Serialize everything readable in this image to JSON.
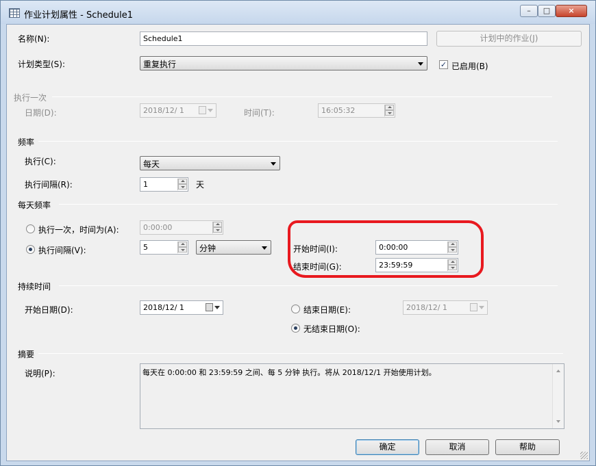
{
  "window": {
    "title": "作业计划属性 - Schedule1",
    "controls": {
      "minimize": "–",
      "maximize": "□",
      "close": "×"
    }
  },
  "name": {
    "label": "名称(N):",
    "value": "Schedule1"
  },
  "jobs_button": "计划中的作业(J)",
  "schedule_type": {
    "label": "计划类型(S):",
    "value": "重复执行"
  },
  "enabled": {
    "label": "已启用(B)",
    "checked": true
  },
  "once": {
    "header": "执行一次",
    "date_label": "日期(D):",
    "date_value": "2018/12/ 1",
    "time_label": "时间(T):",
    "time_value": "16:05:32"
  },
  "frequency": {
    "header": "频率",
    "occurs_label": "执行(C):",
    "occurs_value": "每天",
    "recurs_label": "执行间隔(R):",
    "recurs_value": "1",
    "recurs_unit": "天"
  },
  "daily": {
    "header": "每天频率",
    "once_at_label": "执行一次，时间为(A):",
    "once_at_value": "0:00:00",
    "once_at_selected": false,
    "every_label": "执行间隔(V):",
    "every_value": "5",
    "every_unit": "分钟",
    "every_selected": true,
    "start_label": "开始时间(I):",
    "start_value": "0:00:00",
    "end_label": "结束时间(G):",
    "end_value": "23:59:59"
  },
  "duration": {
    "header": "持续时间",
    "start_label": "开始日期(D):",
    "start_value": "2018/12/ 1",
    "end_label": "结束日期(E):",
    "end_value": "2018/12/ 1",
    "end_selected": false,
    "no_end_label": "无结束日期(O):",
    "no_end_selected": true
  },
  "summary": {
    "header": "摘要",
    "desc_label": "说明(P):",
    "desc_value": "每天在 0:00:00 和 23:59:59 之间、每 5 分钟 执行。将从 2018/12/1 开始使用计划。"
  },
  "buttons": {
    "ok": "确定",
    "cancel": "取消",
    "help": "帮助"
  },
  "colors": {
    "annotation": "#e8191f",
    "titlebar": "#c6d7ec",
    "client": "#f0f0f0"
  }
}
